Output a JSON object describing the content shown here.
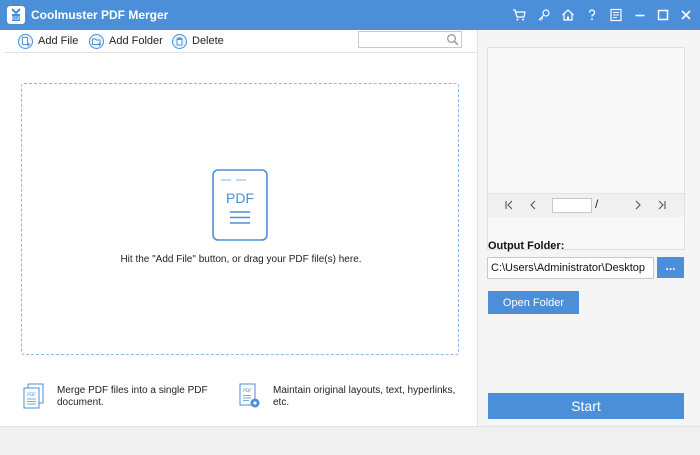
{
  "window": {
    "title": "Coolmuster PDF Merger",
    "accent_color": "#4a8fd8",
    "title_buttons": [
      "cart-icon",
      "key-icon",
      "home-icon",
      "help-icon",
      "feedback-icon",
      "minimize-icon",
      "maximize-icon",
      "close-icon"
    ]
  },
  "toolbar": {
    "add_file_label": "Add File",
    "add_folder_label": "Add Folder",
    "delete_label": "Delete",
    "search_value": "",
    "search_placeholder": ""
  },
  "dropzone": {
    "doc_label": "PDF",
    "hint": "Hit the \"Add File\" button, or drag your PDF file(s) here."
  },
  "features": [
    {
      "icon": "pdf-stack-icon",
      "text": "Merge PDF files into a single PDF document."
    },
    {
      "icon": "pdf-settings-icon",
      "text": "Maintain original layouts, text, hyperlinks, etc."
    }
  ],
  "preview": {
    "page_value": "",
    "page_separator": "/"
  },
  "output": {
    "label": "Output Folder:",
    "path": "C:\\Users\\Administrator\\Desktop",
    "browse_label": "...",
    "open_folder_label": "Open Folder",
    "start_label": "Start"
  }
}
